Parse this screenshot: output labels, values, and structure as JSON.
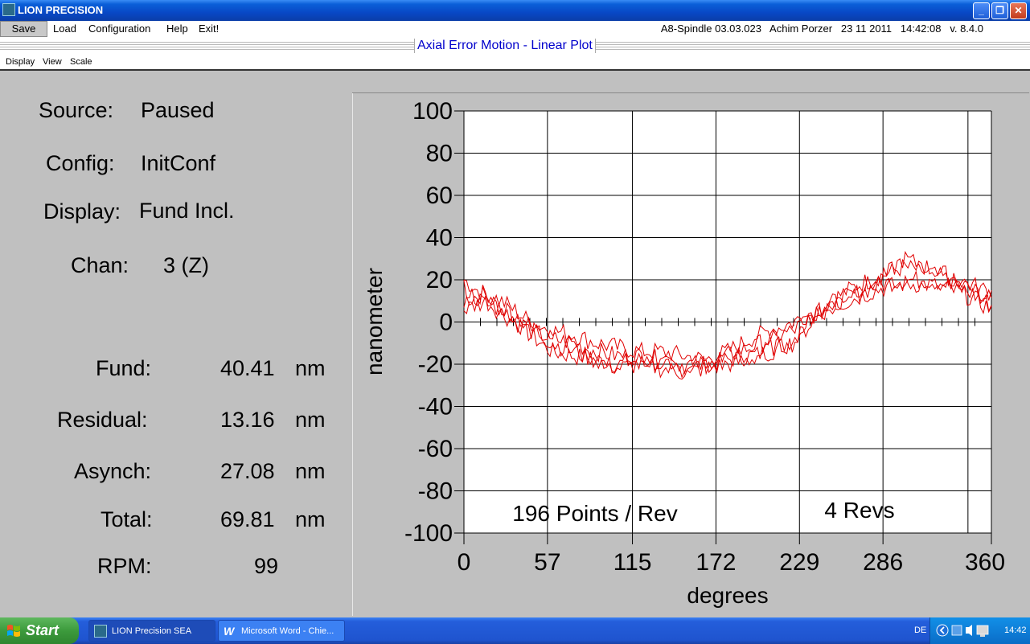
{
  "window": {
    "title": "LION PRECISION",
    "minimize": "_",
    "maximize": "❐",
    "close": "✕"
  },
  "menu": {
    "save": "Save",
    "load": "Load",
    "configuration": "Configuration",
    "help": "Help",
    "exit": "Exit!",
    "info": "A8-Spindle 03.03.023   Achim Porzer   23 11 2011   14:42:08   v. 8.4.0"
  },
  "plot_title": "Axial Error Motion - Linear Plot",
  "submenu": {
    "display": "Display",
    "view": "View",
    "scale": "Scale"
  },
  "status": {
    "source_label": "Source:",
    "source_value": "Paused",
    "config_label": "Config:",
    "config_value": "InitConf",
    "display_label": "Display:",
    "display_value": "Fund Incl.",
    "chan_label": "Chan:",
    "chan_value": "3 (Z)"
  },
  "metrics": [
    {
      "label": "Fund:",
      "value": "40.41",
      "unit": "nm"
    },
    {
      "label": "Residual:",
      "value": "13.16",
      "unit": "nm"
    },
    {
      "label": "Asynch:",
      "value": "27.08",
      "unit": "nm"
    },
    {
      "label": "Total:",
      "value": "69.81",
      "unit": "nm"
    },
    {
      "label": "RPM:",
      "value": "99",
      "unit": ""
    }
  ],
  "chart_data": {
    "type": "line",
    "xlabel": "degrees",
    "ylabel": "nanometer",
    "xlim": [
      0,
      360
    ],
    "ylim": [
      -100,
      100
    ],
    "x_ticks": [
      "0",
      "57",
      "115",
      "172",
      "229",
      "286",
      "360"
    ],
    "x_tick_values": [
      0,
      57,
      115,
      172,
      229,
      286,
      344
    ],
    "y_ticks": [
      "100",
      "80",
      "60",
      "40",
      "20",
      "0",
      "-20",
      "-40",
      "-60",
      "-80",
      "-100"
    ],
    "annotations": [
      "196 Points / Rev",
      "4 Revs"
    ],
    "line_color": "#e00000",
    "grid": true,
    "points_per_rev": 196,
    "revs": 4,
    "series": [
      {
        "x": [
          0,
          15,
          30,
          45,
          60,
          75,
          90,
          105,
          120,
          135,
          150,
          165,
          180,
          195,
          210,
          225,
          240,
          255,
          270,
          285,
          300,
          315,
          330,
          345,
          360
        ],
        "y": [
          20,
          12,
          4,
          -6,
          -14,
          -16,
          -18,
          -20,
          -18,
          -20,
          -22,
          -20,
          -18,
          -16,
          -14,
          -8,
          5,
          12,
          18,
          22,
          26,
          24,
          20,
          16,
          10
        ]
      },
      {
        "x": [
          0,
          15,
          30,
          45,
          60,
          75,
          90,
          105,
          120,
          135,
          150,
          165,
          180,
          195,
          210,
          225,
          240,
          255,
          270,
          285,
          300,
          315,
          330,
          345,
          360
        ],
        "y": [
          10,
          14,
          8,
          0,
          -4,
          -6,
          -10,
          -12,
          -14,
          -14,
          -16,
          -18,
          -14,
          -8,
          -4,
          0,
          6,
          10,
          14,
          18,
          20,
          20,
          18,
          14,
          8
        ]
      },
      {
        "x": [
          0,
          15,
          30,
          45,
          60,
          75,
          90,
          105,
          120,
          135,
          150,
          165,
          180,
          195,
          210,
          225,
          240,
          255,
          270,
          285,
          300,
          315,
          330,
          345,
          360
        ],
        "y": [
          6,
          10,
          2,
          -4,
          -8,
          -10,
          -14,
          -16,
          -16,
          -18,
          -20,
          -20,
          -16,
          -12,
          -8,
          -4,
          4,
          8,
          12,
          16,
          18,
          18,
          16,
          12,
          6
        ]
      },
      {
        "x": [
          0,
          15,
          30,
          45,
          60,
          75,
          90,
          105,
          120,
          135,
          150,
          165,
          180,
          195,
          210,
          225,
          240,
          255,
          270,
          285,
          300,
          315,
          330,
          345,
          360
        ],
        "y": [
          16,
          8,
          6,
          -2,
          -10,
          -14,
          -18,
          -22,
          -20,
          -22,
          -24,
          -22,
          -20,
          -18,
          -12,
          -10,
          2,
          10,
          16,
          20,
          30,
          26,
          22,
          18,
          14
        ]
      }
    ]
  },
  "taskbar": {
    "start": "Start",
    "items": [
      "LION Precision  SEA",
      "Microsoft Word - Chie..."
    ],
    "lang": "DE",
    "time": "14:42"
  }
}
